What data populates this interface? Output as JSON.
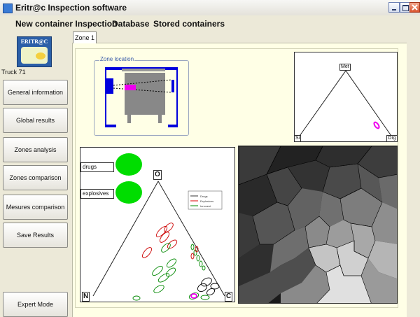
{
  "window": {
    "title": "Eritr@c Inspection software"
  },
  "menu": [
    "New container Inspection",
    "Database",
    "Stored containers"
  ],
  "sidebar": {
    "logo_text": "ERITR@C",
    "truck_label": "Truck 71",
    "buttons": [
      "General information",
      "Global results",
      "Zones analysis",
      "Zones comparison",
      "Mesures comparison",
      "Save Results"
    ],
    "expert_mode": "Expert Mode"
  },
  "tabs": [
    "Zone 1"
  ],
  "zone": {
    "legend": "Zone location"
  },
  "ternary": {
    "top_label": "Met",
    "left_label": "Si",
    "right_label": "Org"
  },
  "plot": {
    "labels": [
      "drugs",
      "explosives"
    ],
    "vertices": {
      "top": "O",
      "left": "N",
      "right": "C"
    },
    "legend": [
      "Drugs",
      "Explosives",
      "Innocent"
    ]
  },
  "colors": {
    "accent": "#00dd00",
    "highlight": "#ee00ee",
    "frame_blue": "#0000dd",
    "panel_bg": "#ffffe6"
  }
}
